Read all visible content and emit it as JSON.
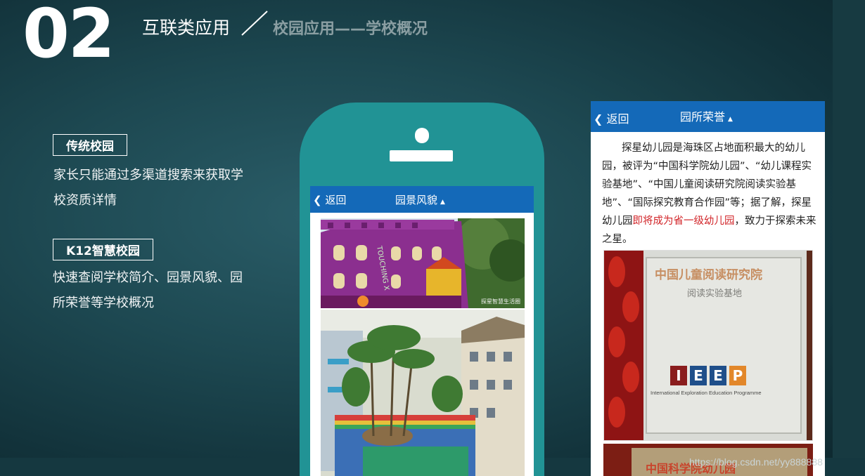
{
  "slide": {
    "number": "02",
    "title": "互联类应用",
    "subtitle": "校园应用——学校概况"
  },
  "sections": [
    {
      "tag": "传统校园",
      "text_lines": [
        "家长只能通过多渠道搜索来获取学",
        "校资质详情"
      ]
    },
    {
      "tag": "K12智慧校园",
      "text_lines": [
        "快速查阅学校简介、园景风貌、园",
        "所荣誉等学校概况"
      ]
    }
  ],
  "phone_app": {
    "back_label": "返回",
    "title": "园景风貌",
    "title_arrow": "▲",
    "photo_caption": "探星智慧生活圈"
  },
  "honor_app": {
    "back_label": "返回",
    "title": "园所荣誉",
    "title_arrow": "▲",
    "description_part1": "探星幼儿园是海珠区占地面积最大的幼儿园，被评为“中国科学院幼儿园”、“幼儿课程实验基地”、“中国儿童阅读研究院阅读实验基地”、“国际探究教育合作园”等；据了解，探星幼儿园",
    "description_highlight": "即将成为省一级幼儿园",
    "description_part2": "，致力于探索未来之星。",
    "plaque": {
      "line1": "中国儿童阅读研究院",
      "line2": "阅读实验基地",
      "logo_letters": [
        "I",
        "E",
        "E",
        "P"
      ],
      "logo_text": "International Exploration Education Programme",
      "bottom_plaque": "中国科学院幼儿园"
    }
  },
  "watermark": "https://blog.csdn.net/yy888888",
  "colors": {
    "app_header": "#1469b8",
    "phone_body": "#219395",
    "highlight_red": "#d2262a",
    "subtitle_gray": "#8a9ea2"
  }
}
